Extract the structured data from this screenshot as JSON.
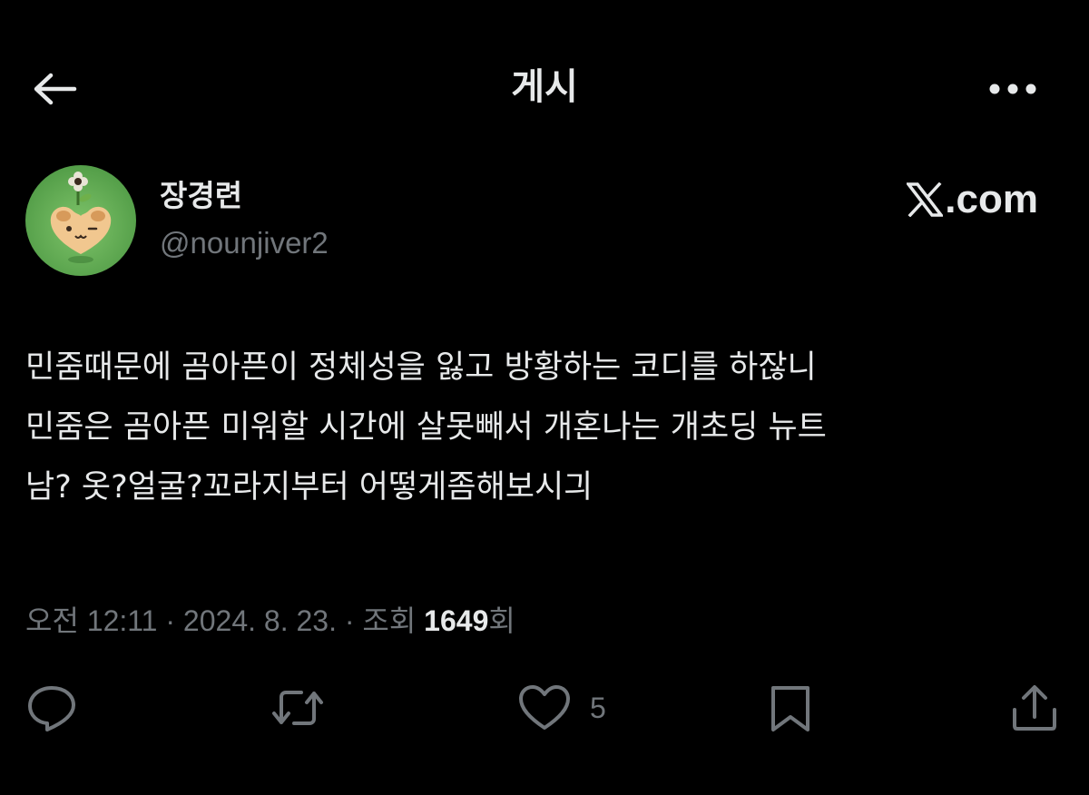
{
  "header": {
    "title": "게시",
    "back_icon": "arrow-left-icon",
    "more_icon": "more-horizontal-icon"
  },
  "author": {
    "display_name": "장경련",
    "handle": "@nounjiver2",
    "avatar": "avatar-image"
  },
  "brand": {
    "mark": "x-logo-icon",
    "text": ".com"
  },
  "post": {
    "lines": [
      "민줌때문에 곰아픈이 정체성을 잃고 방황하는 코디를 하잖니",
      "민줌은 곰아픈 미워할 시간에 살못빼서 개혼나는 개초딩 뉴트",
      "남? 옷?얼굴?꼬라지부터 어떻게좀해보시긔"
    ]
  },
  "meta": {
    "time": "오전 12:11",
    "separator": "·",
    "date": "2024. 8. 23.",
    "views_label": "조회",
    "views_count": "1649",
    "views_unit": "회"
  },
  "actions": {
    "reply_icon": "reply-icon",
    "repost_icon": "repost-icon",
    "like_icon": "heart-icon",
    "like_count": "5",
    "bookmark_icon": "bookmark-icon",
    "share_icon": "share-icon"
  },
  "colors": {
    "background": "#000000",
    "primary_text": "#e7e9ea",
    "secondary_text": "#71767b"
  }
}
